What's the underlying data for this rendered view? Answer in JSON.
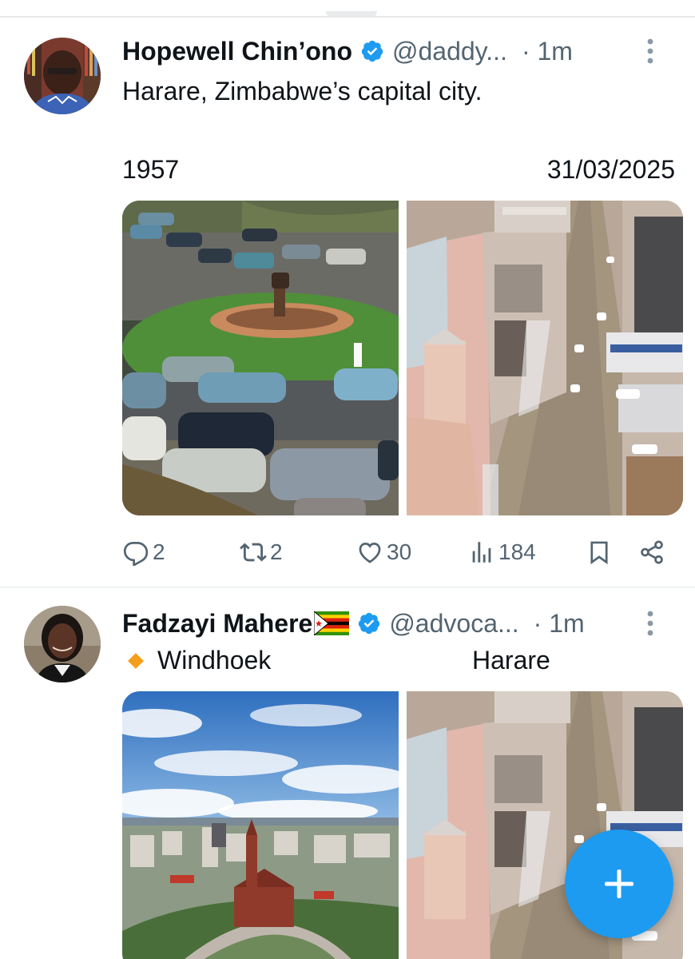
{
  "tweets": [
    {
      "author": "Hopewell Chin’ono",
      "handle": "@daddy...",
      "time": "· 1m",
      "text": "Harare, Zimbabwe’s capital city.",
      "label_left": "1957",
      "label_right": "31/03/2025",
      "images": [
        {
          "description": "1957 Harare roundabout with vintage cars and a statue"
        },
        {
          "description": "2025 aerial view of a Harare street"
        }
      ],
      "stats": {
        "replies": "2",
        "reposts": "2",
        "likes": "30",
        "views": "184"
      }
    },
    {
      "author": "Fadzayi Mahere",
      "author_flag": "🇿🇼",
      "handle": "@advoca...",
      "time": "· 1m",
      "label_left": "Windhoek",
      "label_right": "Harare",
      "images": [
        {
          "description": "Windhoek aerial view with church and blue sky"
        },
        {
          "description": "Harare aerial street view"
        }
      ]
    }
  ],
  "icons": {
    "verified": "verified-badge-icon",
    "more": "more-vertical-icon",
    "reply": "reply-icon",
    "repost": "repost-icon",
    "like": "heart-icon",
    "views": "views-bar-icon",
    "bookmark": "bookmark-icon",
    "share": "share-icon",
    "compose": "plus-icon"
  },
  "colors": {
    "accent": "#1d9bf0",
    "muted": "#536471",
    "text": "#0f1419",
    "diamond": "#f59e1b"
  }
}
